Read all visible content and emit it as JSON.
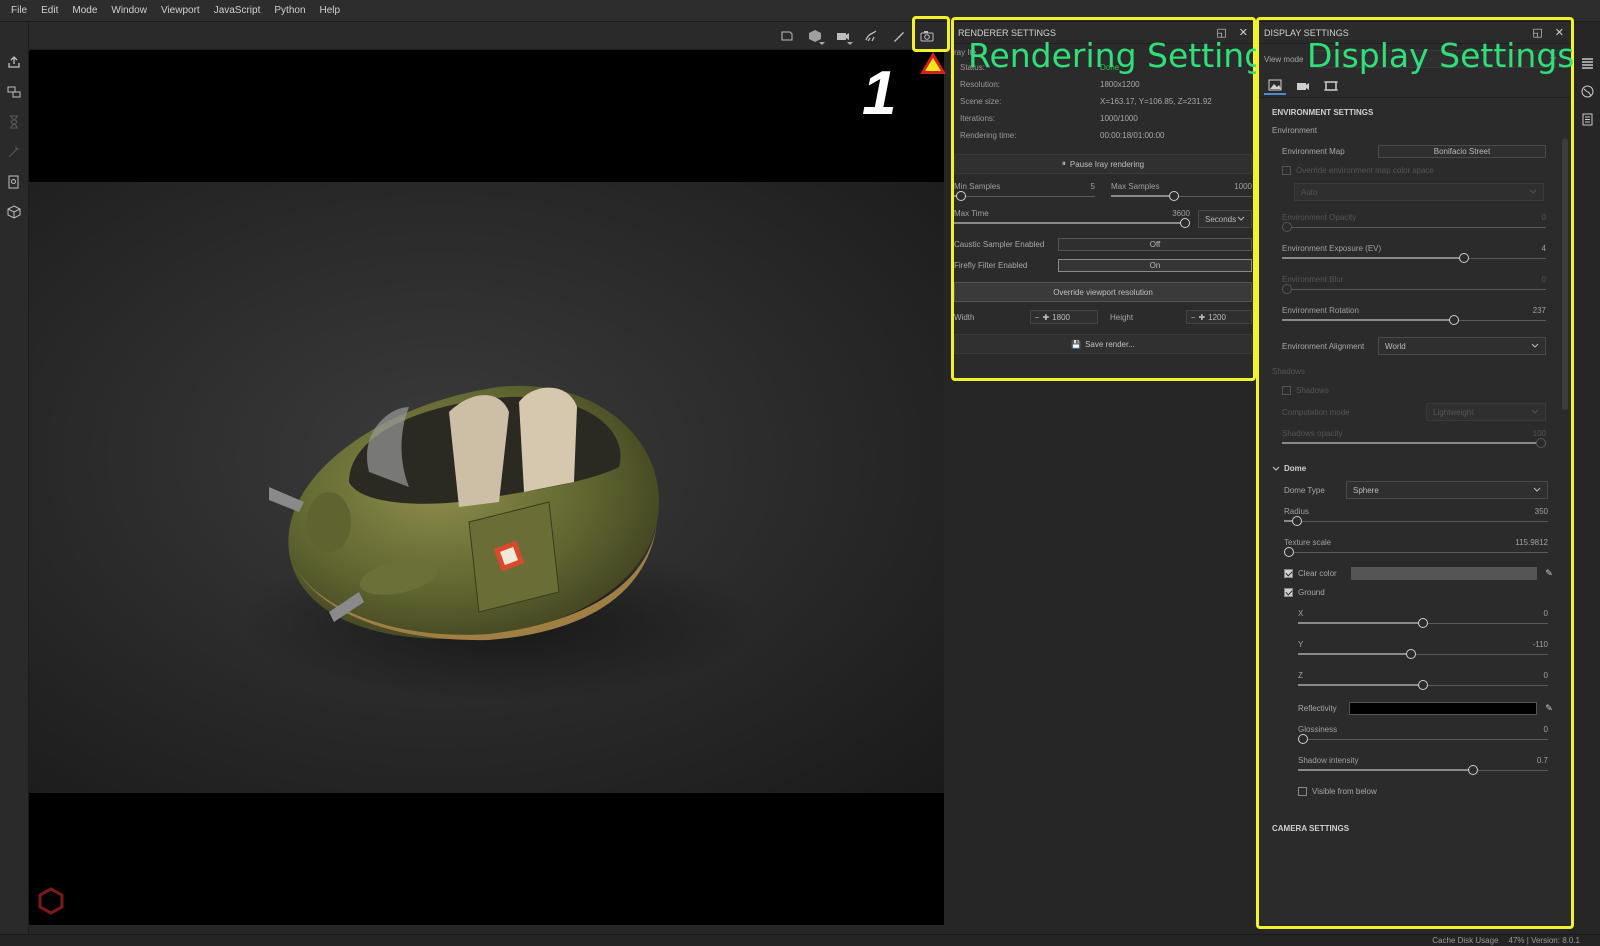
{
  "menu": [
    "File",
    "Edit",
    "Mode",
    "Window",
    "Viewport",
    "JavaScript",
    "Python",
    "Help"
  ],
  "toolbar_icons": [
    "frame-icon",
    "cube-icon",
    "camera-view-icon",
    "animation-icon",
    "brush-icon",
    "render-camera-icon"
  ],
  "annotation": {
    "step_number": "1",
    "rendering_title": "Rendering Settings",
    "display_title": "Display Settings",
    "highlight_color": "#f2f22a",
    "title_color": "#2fe07a"
  },
  "renderer": {
    "header": "RENDERER SETTINGS",
    "iray_label": "ray Ite",
    "info": [
      {
        "k": "Status:",
        "v": "Done"
      },
      {
        "k": "Resolution:",
        "v": "1800x1200"
      },
      {
        "k": "Scene size:",
        "v": "X=163.17, Y=106.85, Z=231.92"
      },
      {
        "k": "Iterations:",
        "v": "1000/1000"
      },
      {
        "k": "Rendering time:",
        "v": "00:00:18/01:00:00"
      }
    ],
    "pause_button": "Pause Iray rendering",
    "min_samples": {
      "label": "Min Samples",
      "value": "5",
      "fraction": 0.05
    },
    "max_samples": {
      "label": "Max Samples",
      "value": "1000",
      "fraction": 0.45
    },
    "max_time": {
      "label": "Max Time",
      "value": "3600",
      "fraction": 1.0,
      "unit": "Seconds"
    },
    "caustic": {
      "label": "Caustic Sampler Enabled",
      "value": "Off"
    },
    "firefly": {
      "label": "Firefly Filter Enabled",
      "value": "On"
    },
    "override_button": "Override viewport resolution",
    "width_label": "Width",
    "width_value": "1800",
    "height_label": "Height",
    "height_value": "1200",
    "save_button": "Save render..."
  },
  "display": {
    "header": "DISPLAY SETTINGS",
    "view_mode_label": "View mode",
    "env_section": "ENVIRONMENT SETTINGS",
    "env_sub": "Environment",
    "env_map_label": "Environment Map",
    "env_map_value": "Bonifacio Street",
    "override_cs_label": "Override environment map color space",
    "auto_value": "Auto",
    "env_opacity": {
      "label": "Environment Opacity",
      "value": "0",
      "fraction": 0.0
    },
    "env_exposure": {
      "label": "Environment Exposure (EV)",
      "value": "4",
      "fraction": 0.69
    },
    "env_blur": {
      "label": "Environment Blur",
      "value": "0",
      "fraction": 0.0
    },
    "env_rotation": {
      "label": "Environment Rotation",
      "value": "237",
      "fraction": 0.65
    },
    "env_alignment_label": "Environment Alignment",
    "env_alignment_value": "World",
    "shadows_sub": "Shadows",
    "shadows_check": "Shadows",
    "computation_label": "Computation mode",
    "computation_value": "Lightweight",
    "shadows_opacity": {
      "label": "Shadows opacity",
      "value": "100",
      "fraction": 1.0
    },
    "dome_section": "Dome",
    "dome_type_label": "Dome Type",
    "dome_type_value": "Sphere",
    "radius": {
      "label": "Radius",
      "value": "350",
      "fraction": 0.05
    },
    "texture_scale": {
      "label": "Texture scale",
      "value": "115.9812",
      "fraction": 0.02
    },
    "clear_color_label": "Clear color",
    "ground_label": "Ground",
    "gx": {
      "label": "X",
      "value": "0",
      "fraction": 0.5
    },
    "gy": {
      "label": "Y",
      "value": "-110",
      "fraction": 0.45
    },
    "gz": {
      "label": "Z",
      "value": "0",
      "fraction": 0.5
    },
    "reflectivity_label": "Reflectivity",
    "glossiness": {
      "label": "Glossiness",
      "value": "0",
      "fraction": 0.0
    },
    "shadow_intensity": {
      "label": "Shadow intensity",
      "value": "0.7",
      "fraction": 0.7
    },
    "visible_below_label": "Visible from below",
    "camera_section": "CAMERA SETTINGS"
  },
  "status": {
    "cache": "Cache Disk Usage",
    "usage_version": "47% | Version: 8.0.1"
  }
}
